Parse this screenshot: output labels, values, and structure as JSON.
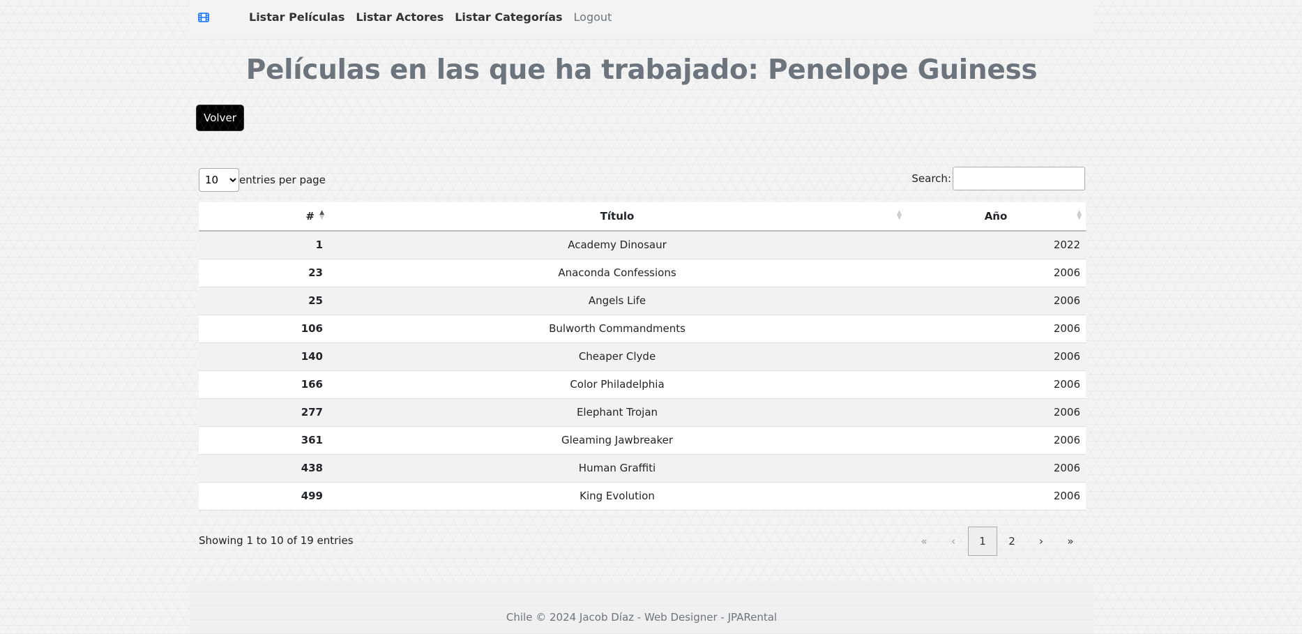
{
  "nav": {
    "brand_icon": "film-icon",
    "brand_color": "#0d6efd",
    "links": [
      "Listar Películas",
      "Listar Actores",
      "Listar Categorías"
    ],
    "logout": "Logout"
  },
  "page": {
    "title": "Películas en las que ha trabajado: Penelope Guiness",
    "back_label": "Volver"
  },
  "controls": {
    "entries_value": "10",
    "entries_label": "entries per page",
    "search_label": "Search:",
    "search_value": ""
  },
  "table": {
    "headers": [
      "#",
      "Título",
      "Año"
    ],
    "sort_column": "#",
    "sort_direction": "ascending",
    "rows": [
      [
        "1",
        "Academy Dinosaur",
        "2022"
      ],
      [
        "23",
        "Anaconda Confessions",
        "2006"
      ],
      [
        "25",
        "Angels Life",
        "2006"
      ],
      [
        "106",
        "Bulworth Commandments",
        "2006"
      ],
      [
        "140",
        "Cheaper Clyde",
        "2006"
      ],
      [
        "166",
        "Color Philadelphia",
        "2006"
      ],
      [
        "277",
        "Elephant Trojan",
        "2006"
      ],
      [
        "361",
        "Gleaming Jawbreaker",
        "2006"
      ],
      [
        "438",
        "Human Graffiti",
        "2006"
      ],
      [
        "499",
        "King Evolution",
        "2006"
      ]
    ]
  },
  "pagination": {
    "info": "Showing 1 to 10 of 19 entries",
    "first": "«",
    "prev": "‹",
    "pages": [
      "1",
      "2"
    ],
    "current": "1",
    "next": "›",
    "last": "»"
  },
  "footer": {
    "text": "Chile © 2024 Jacob Díaz - Web Designer - JPARental"
  }
}
